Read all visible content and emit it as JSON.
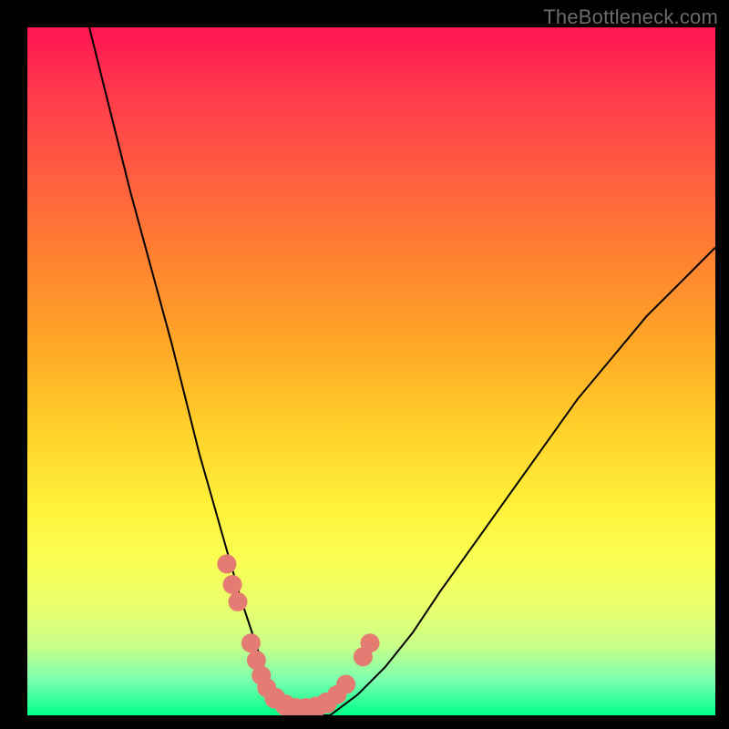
{
  "watermark": "TheBottleneck.com",
  "colors": {
    "frame": "#000000",
    "gradient_top": "#ff1452",
    "gradient_bottom": "#00ff87",
    "curve": "#000000",
    "marker": "#e47c73"
  },
  "chart_data": {
    "type": "line",
    "title": "",
    "xlabel": "",
    "ylabel": "",
    "xlim": [
      0,
      100
    ],
    "ylim": [
      0,
      100
    ],
    "grid": false,
    "series": [
      {
        "name": "curve",
        "x": [
          9,
          12,
          15,
          18,
          21,
          23,
          25,
          27,
          29,
          31,
          33,
          34,
          35,
          37,
          40,
          44,
          48,
          52,
          56,
          60,
          65,
          70,
          75,
          80,
          85,
          90,
          95,
          100
        ],
        "y": [
          100,
          88,
          76,
          65,
          54,
          46,
          38,
          31,
          24,
          17,
          11,
          8,
          5,
          2,
          0,
          0,
          3,
          7,
          12,
          18,
          25,
          32,
          39,
          46,
          52,
          58,
          63,
          68
        ]
      }
    ],
    "markers": {
      "name": "highlighted-points",
      "points": [
        {
          "x": 29.0,
          "y": 22.0
        },
        {
          "x": 29.8,
          "y": 19.0
        },
        {
          "x": 30.6,
          "y": 16.5
        },
        {
          "x": 32.5,
          "y": 10.5
        },
        {
          "x": 33.3,
          "y": 8.0
        },
        {
          "x": 34.0,
          "y": 5.8
        },
        {
          "x": 34.8,
          "y": 4.0
        },
        {
          "x": 36.0,
          "y": 2.5
        },
        {
          "x": 37.5,
          "y": 1.5
        },
        {
          "x": 39.0,
          "y": 1.0
        },
        {
          "x": 40.5,
          "y": 1.0
        },
        {
          "x": 42.0,
          "y": 1.2
        },
        {
          "x": 43.5,
          "y": 1.8
        },
        {
          "x": 45.0,
          "y": 3.0
        },
        {
          "x": 46.3,
          "y": 4.5
        },
        {
          "x": 48.8,
          "y": 8.5
        },
        {
          "x": 49.8,
          "y": 10.5
        }
      ]
    }
  }
}
